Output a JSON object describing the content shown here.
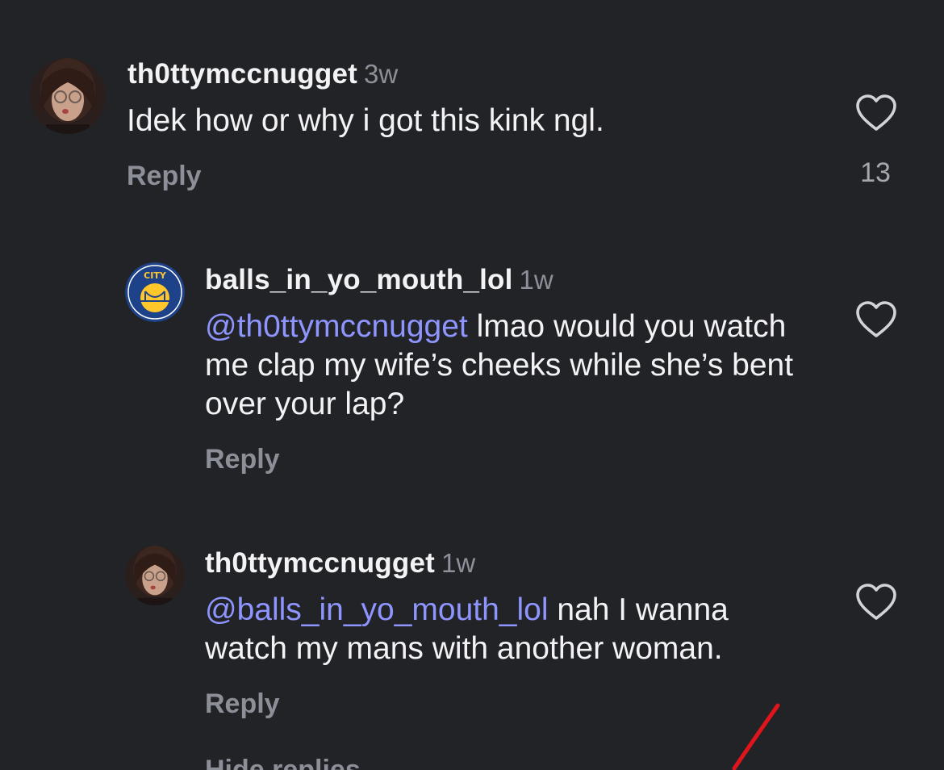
{
  "comments": [
    {
      "username": "th0ttymccnugget",
      "time": "3w",
      "mention": "",
      "text": "Idek how or why i got this kink ngl.",
      "reply_label": "Reply",
      "like_count": "13"
    },
    {
      "username": "balls_in_yo_mouth_lol",
      "time": "1w",
      "mention": "@th0ttymccnugget",
      "text": " lmao would you watch me clap my wife’s cheeks while she’s bent over your lap?",
      "reply_label": "Reply",
      "like_count": ""
    },
    {
      "username": "th0ttymccnugget",
      "time": "1w",
      "mention": "@balls_in_yo_mouth_lol",
      "text": " nah I wanna watch my mans with another woman.",
      "reply_label": "Reply",
      "like_count": ""
    }
  ],
  "hidden_replies_label": "Hide replies",
  "icons": {
    "like": "heart-outline-icon",
    "avatar_1": "profile-photo",
    "avatar_2": "city-logo-badge"
  },
  "colors": {
    "background": "#222327",
    "mention": "#8e95ff",
    "muted": "#8d8f98",
    "annotation": "#e0141b"
  }
}
